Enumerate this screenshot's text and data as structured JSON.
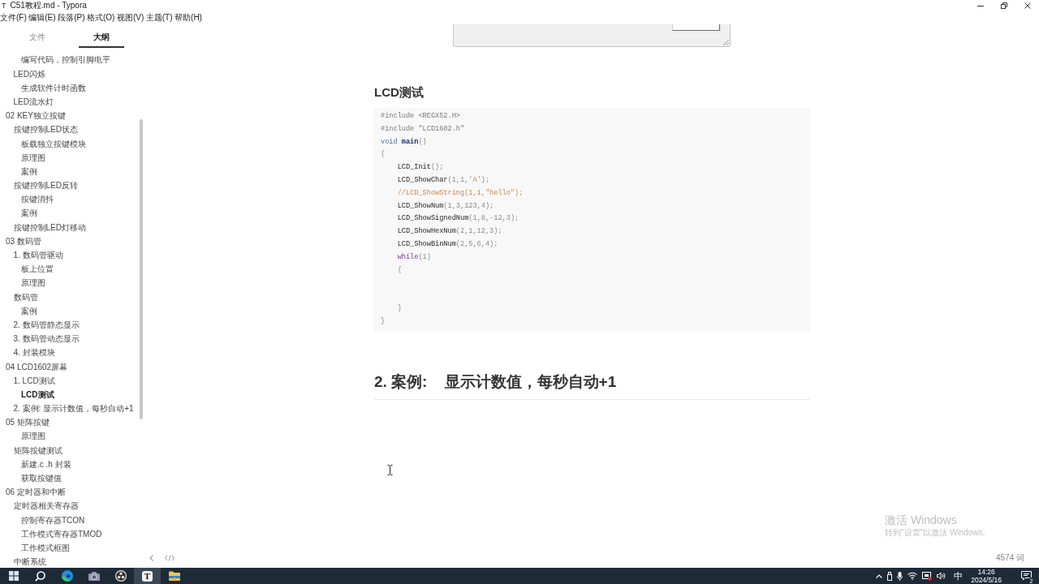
{
  "window": {
    "icon": "T",
    "title": "C51教程.md - Typora"
  },
  "menu": [
    "文件(F)",
    "编辑(E)",
    "段落(P)",
    "格式(O)",
    "视图(V)",
    "主题(T)",
    "帮助(H)"
  ],
  "sidebar": {
    "tabs": [
      {
        "label": "文件",
        "selected": false
      },
      {
        "label": "大纲",
        "selected": true
      }
    ],
    "outline": [
      {
        "children": [
          {
            "children": [
              {
                "label": "编写代码，控制引脚电平",
                "selected": false
              }
            ]
          },
          {
            "label": "LED闪烁",
            "selected": false,
            "children": [
              {
                "label": "生成软件计时函数",
                "selected": false
              }
            ]
          },
          {
            "label": "LED流水灯",
            "selected": false
          }
        ]
      },
      {
        "label": "02 KEY独立按键",
        "selected": false,
        "children": [
          {
            "label": "按键控制LED状态",
            "selected": false,
            "children": [
              {
                "label": "板载独立按键模块",
                "selected": false
              },
              {
                "label": "原理图",
                "selected": false
              },
              {
                "label": "案例",
                "selected": false
              }
            ]
          },
          {
            "label": "按键控制LED反转",
            "selected": false,
            "children": [
              {
                "label": "按键消抖",
                "selected": false
              },
              {
                "label": "案例",
                "selected": false
              }
            ]
          },
          {
            "label": "按键控制LED灯移动",
            "selected": false
          }
        ]
      },
      {
        "label": "03 数码管",
        "selected": false,
        "children": [
          {
            "label": "1. 数码管驱动",
            "selected": false,
            "children": [
              {
                "label": "板上位置",
                "selected": false
              },
              {
                "label": "原理图",
                "selected": false
              }
            ]
          },
          {
            "label": "数码管",
            "selected": false,
            "children": [
              {
                "label": "案例",
                "selected": false
              }
            ]
          },
          {
            "label": "2. 数码管静态显示",
            "selected": false
          },
          {
            "label": "3. 数码管动态显示",
            "selected": false
          },
          {
            "label": "4. 封装模块",
            "selected": false
          }
        ]
      },
      {
        "label": "04 LCD1602屏幕",
        "selected": false,
        "children": [
          {
            "label": "1. LCD测试",
            "selected": false,
            "children": [
              {
                "label": "LCD测试",
                "selected": true
              }
            ]
          },
          {
            "label": "2. 案例: 显示计数值，每秒自动+1",
            "selected": false
          }
        ]
      },
      {
        "label": "05 矩阵按键",
        "selected": false,
        "children": [
          {
            "children": [
              {
                "label": "原理图",
                "selected": false
              }
            ]
          },
          {
            "label": "矩阵按键测试",
            "selected": false,
            "children": [
              {
                "label": "新建.c .h 封装",
                "selected": false
              },
              {
                "label": "获取按键值",
                "selected": false
              }
            ]
          }
        ]
      },
      {
        "label": "06 定时器和中断",
        "selected": false,
        "children": [
          {
            "label": "定时器相关寄存器",
            "selected": false,
            "children": [
              {
                "label": "控制寄存器TCON",
                "selected": false
              },
              {
                "label": "工作模式寄存器TMOD",
                "selected": false
              },
              {
                "label": "工作模式框图",
                "selected": false
              }
            ]
          },
          {
            "label": "中断系统",
            "selected": false
          }
        ]
      }
    ]
  },
  "document": {
    "heading": "LCD测试",
    "code": [
      {
        "text": "#include <REGX52.H>\n#include \"LCD1602.h\"\n",
        "kind": "meta"
      },
      {
        "text": "void ",
        "kind": "type"
      },
      {
        "text": "main",
        "kind": "def"
      },
      {
        "text": "()\n{\n",
        "kind": "args"
      },
      {
        "text": "    LCD_Init",
        "kind": "plain"
      },
      {
        "text": "();\n",
        "kind": "args"
      },
      {
        "text": "    LCD_ShowChar",
        "kind": "plain"
      },
      {
        "text": "(1,1,",
        "kind": "args"
      },
      {
        "text": "'A'",
        "kind": "string"
      },
      {
        "text": ");\n",
        "kind": "args"
      },
      {
        "text": "    //LCD_ShowString(1,1,\"hello\");\n",
        "kind": "comment"
      },
      {
        "text": "    LCD_ShowNum",
        "kind": "plain"
      },
      {
        "text": "(1,3,123,4);\n",
        "kind": "args"
      },
      {
        "text": "    LCD_ShowSignedNum",
        "kind": "plain"
      },
      {
        "text": "(1,8,-12,3);\n",
        "kind": "args"
      },
      {
        "text": "    LCD_ShowHexNum",
        "kind": "plain"
      },
      {
        "text": "(2,1,12,3);\n",
        "kind": "args"
      },
      {
        "text": "    LCD_ShowBinNum",
        "kind": "plain"
      },
      {
        "text": "(2,5,6,4);\n",
        "kind": "args"
      },
      {
        "text": "    while",
        "kind": "keyword"
      },
      {
        "text": "(1)\n    {\n\n\n    }\n}",
        "kind": "args"
      }
    ],
    "section_heading": "2. 案例:    显示计数值，每秒自动+1"
  },
  "status_bar": {
    "word_count": "4574 词"
  },
  "activation_notice": {
    "title": "激活 Windows",
    "subtitle": "转到\"设置\"以激活 Windows。"
  },
  "taskbar": {
    "apps": [
      {
        "kind": "start",
        "selected": false
      },
      {
        "kind": "search",
        "selected": false
      },
      {
        "kind": "edge",
        "selected": false
      },
      {
        "kind": "camera",
        "selected": false
      },
      {
        "kind": "obs",
        "selected": false
      },
      {
        "kind": "typora",
        "label": "T",
        "selected": true
      },
      {
        "kind": "explorer",
        "selected": false
      }
    ],
    "input_method": "中",
    "time": "14:26",
    "date": "2024/5/16",
    "notification_count": "2"
  }
}
